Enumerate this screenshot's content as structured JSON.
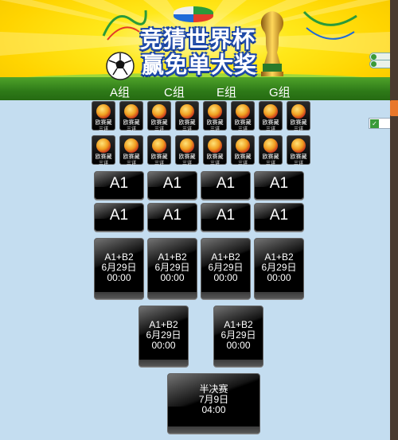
{
  "banner": {
    "title_line1": "竞猜世界杯",
    "title_line2": "赢免单大奖",
    "group_tabs": [
      "A组",
      "C组",
      "E组",
      "G组"
    ]
  },
  "flag_tiles": {
    "label1": "欧赛藏",
    "label2": "三详"
  },
  "round16": {
    "label": "A1"
  },
  "quarter": {
    "teams": "A1+B2",
    "date": "6月29日",
    "time": "00:00"
  },
  "semi": {
    "teams": "A1+B2",
    "date": "6月29日",
    "time": "00:00"
  },
  "final": {
    "stage": "半决赛",
    "date": "7月9日",
    "time": "04:00"
  },
  "colors": {
    "banner_yellow": "#ffd400",
    "grass": "#2e7a18",
    "page_bg": "#c4ddf0",
    "card": "#000000"
  }
}
